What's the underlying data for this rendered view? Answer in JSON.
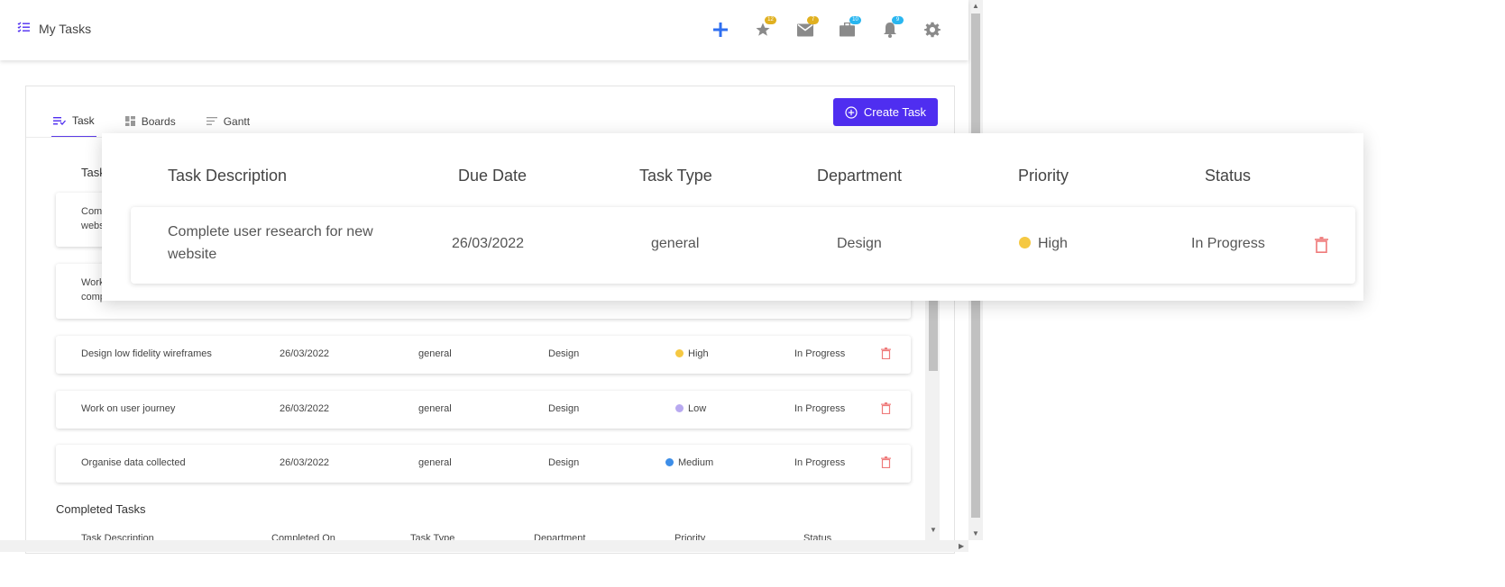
{
  "header": {
    "title": "My Tasks",
    "badges": {
      "star": "12",
      "mail": "7",
      "briefcase": "10",
      "bell": "9"
    }
  },
  "tabs": [
    {
      "label": "Task"
    },
    {
      "label": "Boards"
    },
    {
      "label": "Gantt"
    }
  ],
  "create_button": "Create Task",
  "tasks_section": {
    "label_partial": "Task"
  },
  "partial_rows": [
    {
      "line1": "Com",
      "line2": "webs"
    },
    {
      "line1": "Work",
      "line2": "competitors"
    }
  ],
  "rows": [
    {
      "description": "Design low fidelity wireframes",
      "due": "26/03/2022",
      "type": "general",
      "department": "Design",
      "priority": "High",
      "priority_color": "#f5c842",
      "status": "In Progress"
    },
    {
      "description": "Work on user journey",
      "due": "26/03/2022",
      "type": "general",
      "department": "Design",
      "priority": "Low",
      "priority_color": "#b8a9f0",
      "status": "In Progress"
    },
    {
      "description": "Organise data collected",
      "due": "26/03/2022",
      "type": "general",
      "department": "Design",
      "priority": "Medium",
      "priority_color": "#3d8ee8",
      "status": "In Progress"
    }
  ],
  "completed": {
    "label": "Completed Tasks",
    "headers": [
      "Task Description",
      "Completed On",
      "Task Type",
      "Department",
      "Priority",
      "Status"
    ]
  },
  "popup": {
    "headers": [
      "Task Description",
      "Due Date",
      "Task Type",
      "Department",
      "Priority",
      "Status"
    ],
    "row": {
      "description_line1": "Complete user research for new",
      "description_line2": "website",
      "due": "26/03/2022",
      "type": "general",
      "department": "Design",
      "priority": "High",
      "priority_color": "#f5c842",
      "status": "In Progress"
    }
  },
  "colors": {
    "accent": "#4f2ef0",
    "delete": "#ef7b7b"
  }
}
